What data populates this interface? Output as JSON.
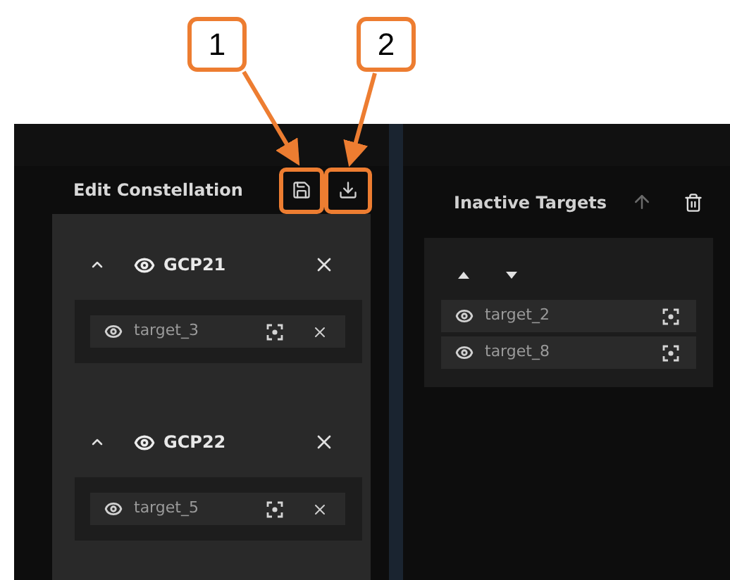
{
  "callouts": [
    {
      "label": "1"
    },
    {
      "label": "2"
    }
  ],
  "edit_panel": {
    "title": "Edit Constellation",
    "groups": [
      {
        "name": "GCP21",
        "expanded": true,
        "targets": [
          {
            "name": "target_3"
          }
        ]
      },
      {
        "name": "GCP22",
        "expanded": true,
        "targets": [
          {
            "name": "target_5"
          }
        ]
      }
    ]
  },
  "inactive_panel": {
    "title": "Inactive Targets",
    "targets": [
      {
        "name": "target_2"
      },
      {
        "name": "target_8"
      }
    ]
  }
}
